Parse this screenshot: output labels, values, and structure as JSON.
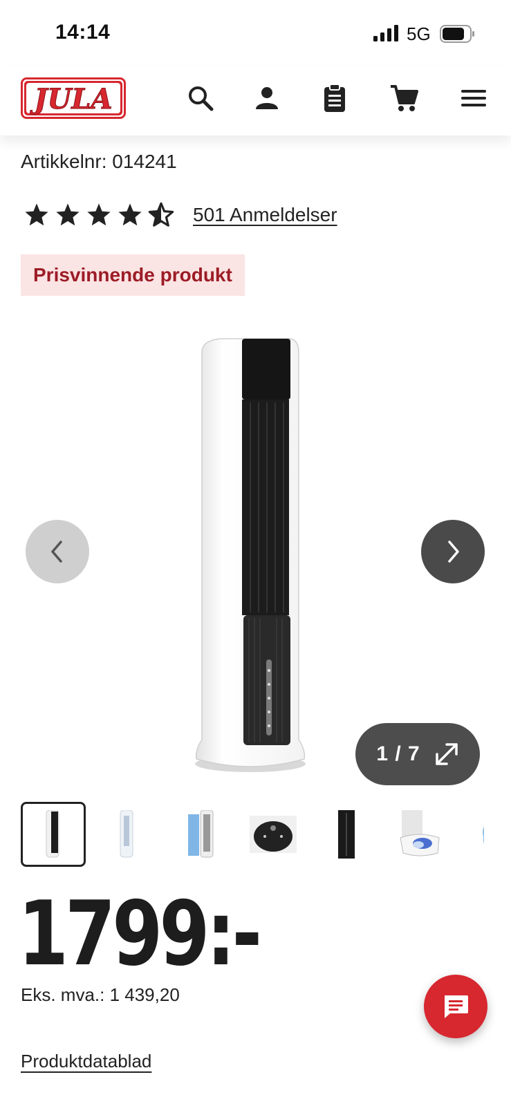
{
  "status_bar": {
    "time": "14:14",
    "network": "5G"
  },
  "header": {
    "logo_text": "JULA",
    "icons": [
      "search-icon",
      "account-icon",
      "clipboard-icon",
      "cart-icon",
      "menu-icon"
    ]
  },
  "product": {
    "article_number": "Artikkelnr: 014241",
    "rating_stars": 4.5,
    "reviews_label": "501 Anmeldelser",
    "badge": "Prisvinnende produkt",
    "image_counter": "1 / 7",
    "price": "1799:-",
    "ex_vat": "Eks. mva.: 1 439,20",
    "datasheet_link": "Produktdatablad"
  },
  "colors": {
    "brand_red": "#d7272f",
    "badge_bg": "#fbe4e4",
    "badge_text": "#9c1c26",
    "nav_dark": "#4a4a4a"
  }
}
